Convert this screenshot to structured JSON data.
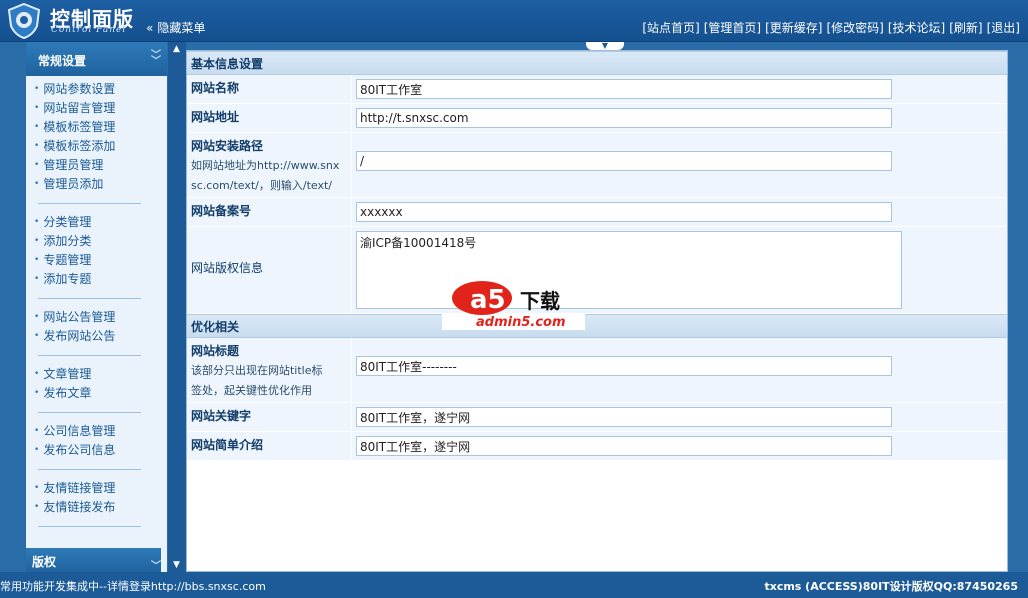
{
  "header": {
    "title": "控制面版",
    "subtitle": "Control Panel",
    "hide_menu": "隐藏菜单",
    "links": [
      "[站点首页]",
      "[管理首页]",
      "[更新缓存]",
      "[修改密码]",
      "[技术论坛]",
      "[刷新]",
      "[退出]"
    ]
  },
  "sidebar": {
    "heading": "常规设置",
    "groups": [
      [
        "网站参数设置",
        "网站留言管理",
        "模板标签管理",
        "模板标签添加",
        "管理员管理",
        "管理员添加"
      ],
      [
        "分类管理",
        "添加分类",
        "专题管理",
        "添加专题"
      ],
      [
        "网站公告管理",
        "发布网站公告"
      ],
      [
        "文章管理",
        "发布文章"
      ],
      [
        "公司信息管理",
        "发布公司信息"
      ],
      [
        "友情链接管理",
        "友情链接发布"
      ]
    ],
    "footer_heading": "版权"
  },
  "main": {
    "basic_section": "基本信息设置",
    "site_name": {
      "label": "网站名称",
      "value": "80IT工作室"
    },
    "site_url": {
      "label": "网站地址",
      "value": "http://t.snxsc.com"
    },
    "install_path": {
      "label": "网站安装路径",
      "note_1": "如网站地址为http://www.snx",
      "note_2": "sc.com/text/，则输入/text/",
      "value": "/"
    },
    "icp": {
      "label": "网站备案号",
      "value": "xxxxxx"
    },
    "copyright": {
      "label": "网站版权信息",
      "value": "渝ICP备10001418号"
    },
    "seo_section": "优化相关",
    "seo_title": {
      "label": "网站标题",
      "note_1": "该部分只出现在网站title标",
      "note_2": "签处，起关键性优化作用",
      "value": "80IT工作室--------"
    },
    "keywords": {
      "label": "网站关键字",
      "value": "80IT工作室，遂宁网"
    },
    "description": {
      "label": "网站简单介绍",
      "value": "80IT工作室，遂宁网"
    }
  },
  "watermark": {
    "brand": "a5下载",
    "url": "admin5.com"
  },
  "footer": {
    "left": "常用功能开发集成中--详情登录http://bbs.snxsc.com",
    "right": "txcms (ACCESS)80IT设计版权QQ:87450265"
  }
}
